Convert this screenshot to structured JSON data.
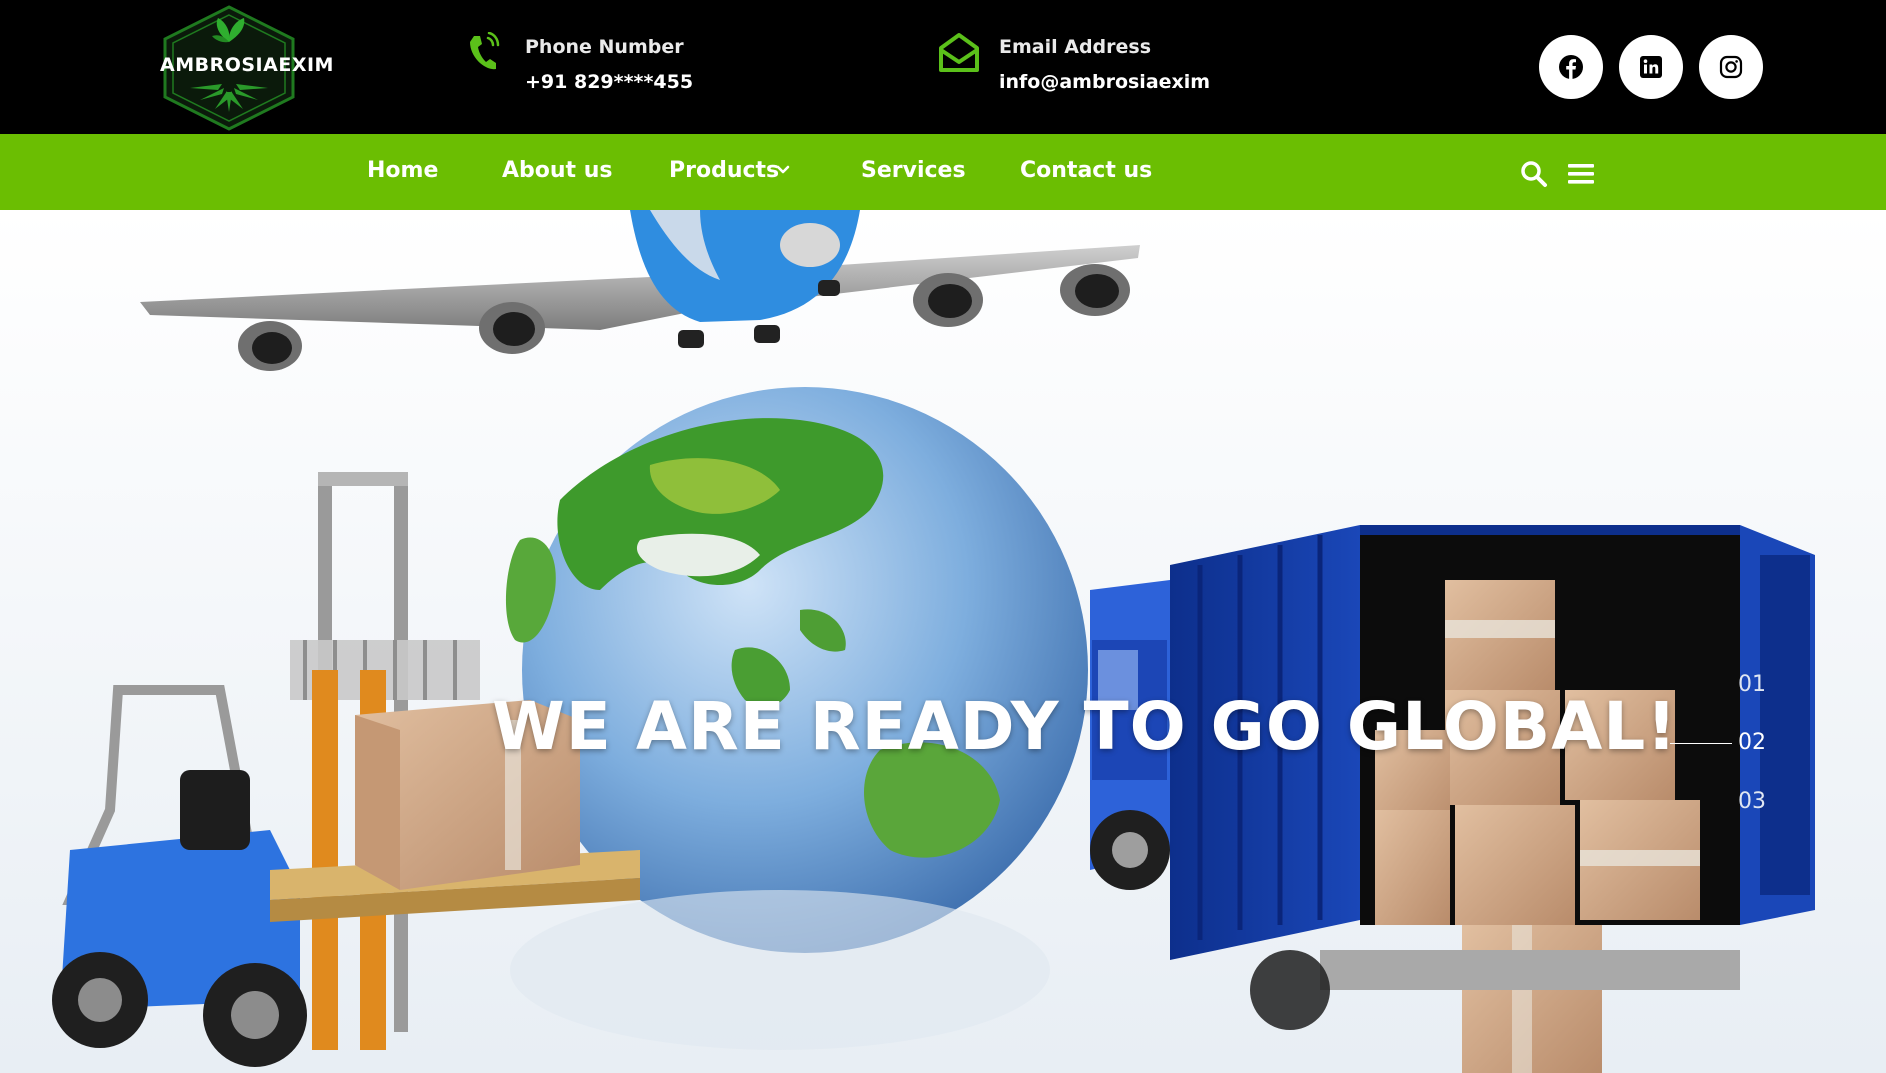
{
  "brand": {
    "logo_text": "AMBROSIAEXIM"
  },
  "contact": {
    "phone": {
      "title": "Phone Number",
      "value": "+91 829****455",
      "icon": "phone-icon"
    },
    "email": {
      "title": "Email Address",
      "value": "info@ambrosiaexim",
      "icon": "envelope-icon"
    }
  },
  "social": [
    {
      "name": "facebook",
      "icon": "facebook-icon"
    },
    {
      "name": "linkedin",
      "icon": "linkedin-icon"
    },
    {
      "name": "instagram",
      "icon": "instagram-icon"
    }
  ],
  "nav": {
    "items": [
      {
        "label": "Home"
      },
      {
        "label": "About us"
      },
      {
        "label": "Products",
        "has_dropdown": true
      },
      {
        "label": "Services"
      },
      {
        "label": "Contact us"
      }
    ],
    "search_icon": "search-icon",
    "menu_icon": "hamburger-menu-icon"
  },
  "hero": {
    "title": "WE ARE READY TO GO GLOBAL!",
    "slides": [
      "01",
      "02",
      "03"
    ],
    "active_slide": "02"
  },
  "colors": {
    "topbar_bg": "#000000",
    "nav_bg": "#6bbe02",
    "accent_green": "#5bc01a",
    "hero_bg": "#ffffff"
  }
}
